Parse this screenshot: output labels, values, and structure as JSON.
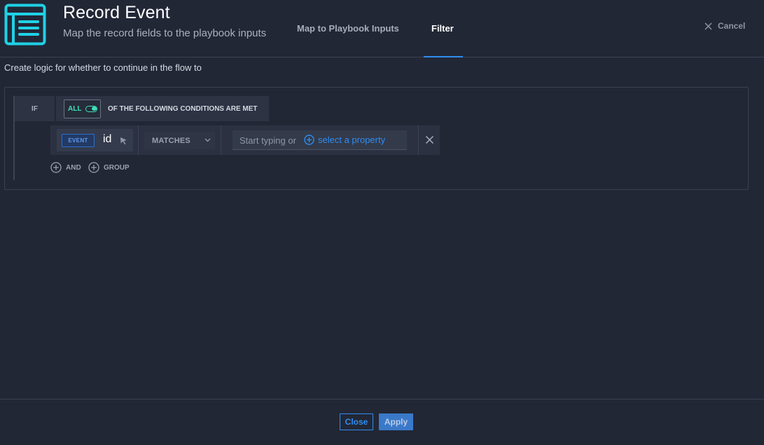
{
  "header": {
    "title": "Record Event",
    "subtitle": "Map the record fields to the playbook inputs",
    "icon": "record-form-icon",
    "tabs": [
      {
        "label": "Map to Playbook Inputs",
        "active": false
      },
      {
        "label": "Filter",
        "active": true
      }
    ],
    "cancel_label": "Cancel"
  },
  "description": "Create logic for whether to continue in the flow to",
  "filter": {
    "if_label": "IF",
    "match_mode": "ALL",
    "match_toggle_on": true,
    "conditions_text": "OF THE FOLLOWING CONDITIONS ARE MET",
    "rule": {
      "badge": "EVENT",
      "property": "id",
      "operator": "MATCHES",
      "value_placeholder": "Start typing or",
      "select_property_label": "select a property"
    },
    "add_and_label": "AND",
    "add_group_label": "GROUP"
  },
  "footer": {
    "close_label": "Close",
    "apply_label": "Apply"
  },
  "colors": {
    "background": "#222736",
    "accent": "#2f8df0",
    "toggle_on": "#3ee0b8",
    "icon": "#1fd1e6"
  }
}
